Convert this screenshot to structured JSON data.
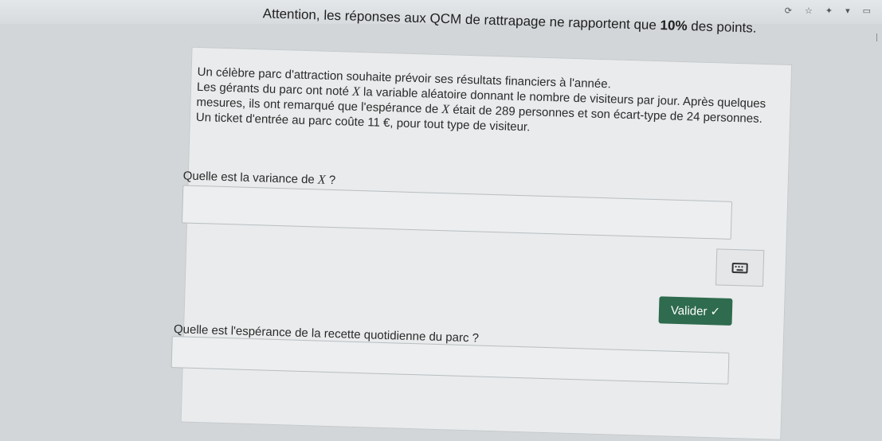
{
  "browser": {
    "toolbar_icons": [
      "reload-icon",
      "star-icon",
      "extension-icon",
      "wifi-icon",
      "menu-icon"
    ]
  },
  "notice": {
    "text_before": "Attention, les réponses aux QCM de rattrapage ne rapportent que ",
    "percent": "10%",
    "text_after": " des points."
  },
  "exercise": {
    "line1": "Un célèbre parc d'attraction souhaite prévoir ses résultats financiers à l'année.",
    "line2a": "Les gérants du parc ont noté ",
    "var_x": "X",
    "line2b": " la variable aléatoire donnant le nombre de visiteurs par jour. Après quelques",
    "line3a": "mesures, ils ont remarqué que l'espérance de ",
    "line3b": " était de 289 personnes et son écart-type de 24 personnes.",
    "line4": "Un ticket d'entrée au parc coûte 11 €, pour tout type de visiteur."
  },
  "question1": {
    "label_before": "Quelle est la variance de ",
    "label_after": " ?",
    "answer_value": ""
  },
  "validate": {
    "label": "Valider",
    "check": "✓"
  },
  "question2": {
    "label": "Quelle est l'espérance de la recette quotidienne du parc ?",
    "answer_value": ""
  },
  "colors": {
    "validate_bg": "#2f6b4e",
    "page_bg": "#d2d6d9"
  }
}
